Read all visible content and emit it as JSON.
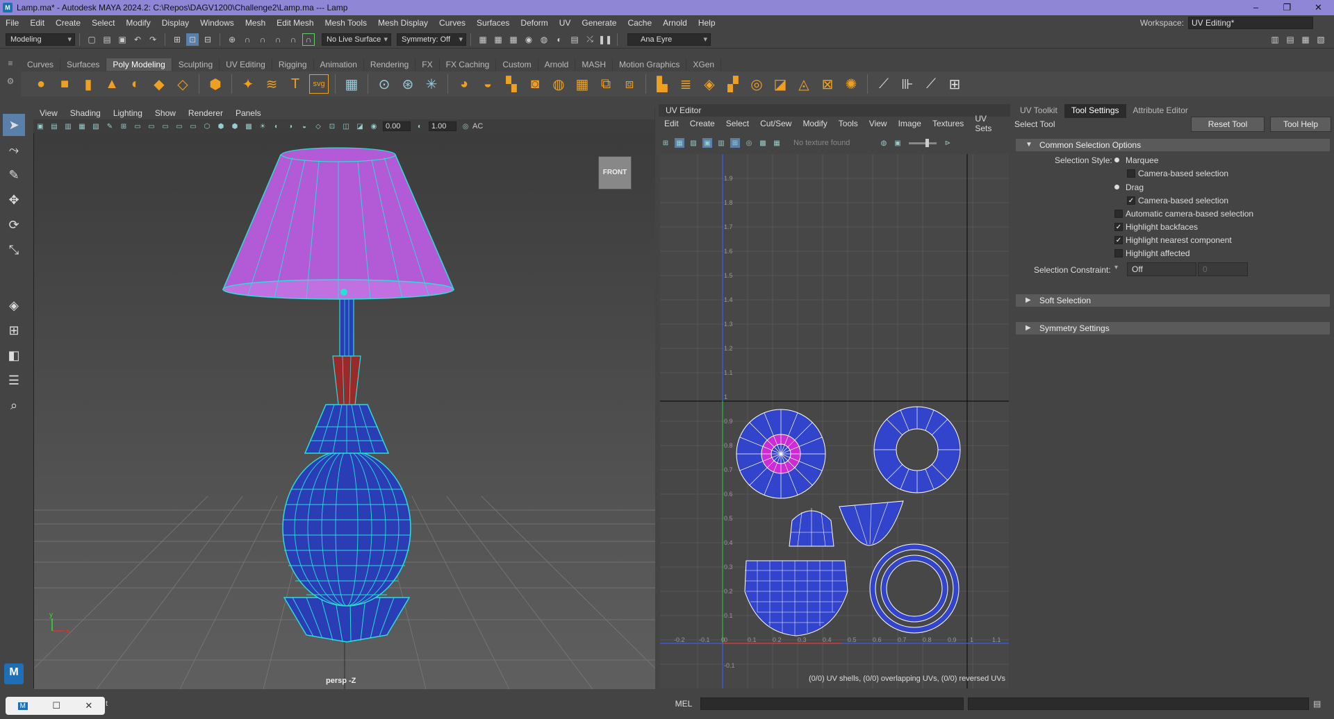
{
  "window": {
    "title": "Lamp.ma* - Autodesk MAYA 2024.2: C:\\Repos\\DAGV1200\\Challenge2\\Lamp.ma   ---   Lamp",
    "app_icon": "M",
    "controls": [
      "–",
      "❐",
      "✕"
    ]
  },
  "menubar": {
    "items": [
      "File",
      "Edit",
      "Create",
      "Select",
      "Modify",
      "Display",
      "Windows",
      "Mesh",
      "Edit Mesh",
      "Mesh Tools",
      "Mesh Display",
      "Curves",
      "Surfaces",
      "Deform",
      "UV",
      "Generate",
      "Cache",
      "Arnold",
      "Help"
    ],
    "workspace_label": "Workspace:",
    "workspace_value": "UV Editing*"
  },
  "statusline": {
    "mode": "Modeling",
    "live_surface": "No Live Surface",
    "symmetry": "Symmetry: Off",
    "user": "Ana Eyre"
  },
  "shelf": {
    "tabs": [
      "Curves",
      "Surfaces",
      "Poly Modeling",
      "Sculpting",
      "UV Editing",
      "Rigging",
      "Animation",
      "Rendering",
      "FX",
      "FX Caching",
      "Custom",
      "Arnold",
      "MASH",
      "Motion Graphics",
      "XGen"
    ],
    "active_tab": "Poly Modeling",
    "svg_label": "svg"
  },
  "viewport": {
    "menus": [
      "View",
      "Shading",
      "Lighting",
      "Show",
      "Renderer",
      "Panels"
    ],
    "near_value": "0.00",
    "far_value": "1.00",
    "aces_label": "AC",
    "camera_label": "persp -Z",
    "viewcube_label": "FRONT",
    "axis_x": "x",
    "axis_y": "y"
  },
  "uv_editor": {
    "title": "UV Editor",
    "menus": [
      "Edit",
      "Create",
      "Select",
      "Cut/Sew",
      "Modify",
      "Tools",
      "View",
      "Image",
      "Textures",
      "UV Sets"
    ],
    "texture_status": "No texture found",
    "status": "(0/0) UV shells, (0/0) overlapping UVs, (0/0) reversed UVs",
    "v_ticks": [
      "1.9",
      "1.8",
      "1.7",
      "1.6",
      "1.5",
      "1.4",
      "1.3",
      "1.2",
      "1.1",
      "1",
      "0.9",
      "0.8",
      "0.7",
      "0.6",
      "0.5",
      "0.4",
      "0.3",
      "0.2",
      "0.1",
      "0",
      "-0.1"
    ],
    "u_ticks": [
      "-0.2",
      "-0.1",
      "0",
      "0.1",
      "0.2",
      "0.3",
      "0.4",
      "0.5",
      "0.6",
      "0.7",
      "0.8",
      "0.9",
      "1",
      "1.1"
    ]
  },
  "attribute_panel": {
    "tabs": [
      "UV Toolkit",
      "Tool Settings",
      "Attribute Editor"
    ],
    "active_tab": "Tool Settings",
    "tool_name": "Select Tool",
    "reset_button": "Reset Tool",
    "help_button": "Tool Help",
    "common_frame": "Common Selection Options",
    "selection_style_label": "Selection Style:",
    "marquee": "Marquee",
    "camera_based_1": "Camera-based selection",
    "drag": "Drag",
    "camera_based_2": "Camera-based selection",
    "auto_camera": "Automatic camera-based selection",
    "highlight_backfaces": "Highlight backfaces",
    "highlight_nearest": "Highlight nearest component",
    "highlight_affected": "Highlight affected",
    "constraint_label": "Selection Constraint:",
    "constraint_value": "Off",
    "constraint_num": "0",
    "soft_selection": "Soft Selection",
    "symmetry_settings": "Symmetry Settings",
    "checks": {
      "camera_based_1": false,
      "camera_based_2": true,
      "auto_camera": false,
      "highlight_backfaces": true,
      "highlight_nearest": true,
      "highlight_affected": false
    }
  },
  "commandline": {
    "label": "MEL"
  },
  "taskbar": {
    "thumb_icon": "M",
    "thumb_text": "t"
  },
  "colors": {
    "title_bar": "#8f86d6",
    "lampshade": "#b35bd6",
    "lamp_body": "#2b3db5",
    "wire": "#27e0d8",
    "uv_shell": "#3344cc",
    "neck_red": "#9a2a2a"
  }
}
